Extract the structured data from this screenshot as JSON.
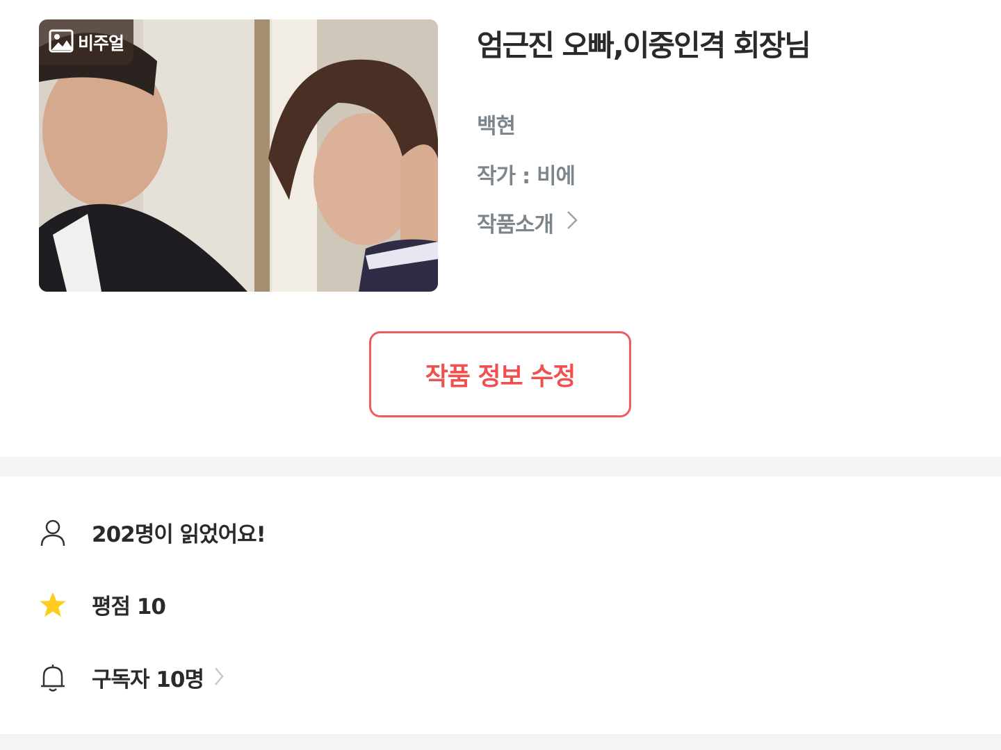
{
  "cover": {
    "badge_label": "비주얼",
    "badge_icon": "image-icon"
  },
  "work": {
    "title": "엄근진 오빠,이중인격 회장님",
    "character": "백현",
    "author": "작가 : 비에",
    "intro_label": "작품소개"
  },
  "actions": {
    "edit_label": "작품 정보 수정"
  },
  "stats": {
    "readers": "202명이 읽었어요!",
    "rating": "평점 10",
    "subscribers": "구독자 10명"
  },
  "colors": {
    "accent": "#ef5050",
    "muted_text": "#7c858b",
    "star": "#ffcc1d",
    "divider": "#f2f4f5"
  }
}
